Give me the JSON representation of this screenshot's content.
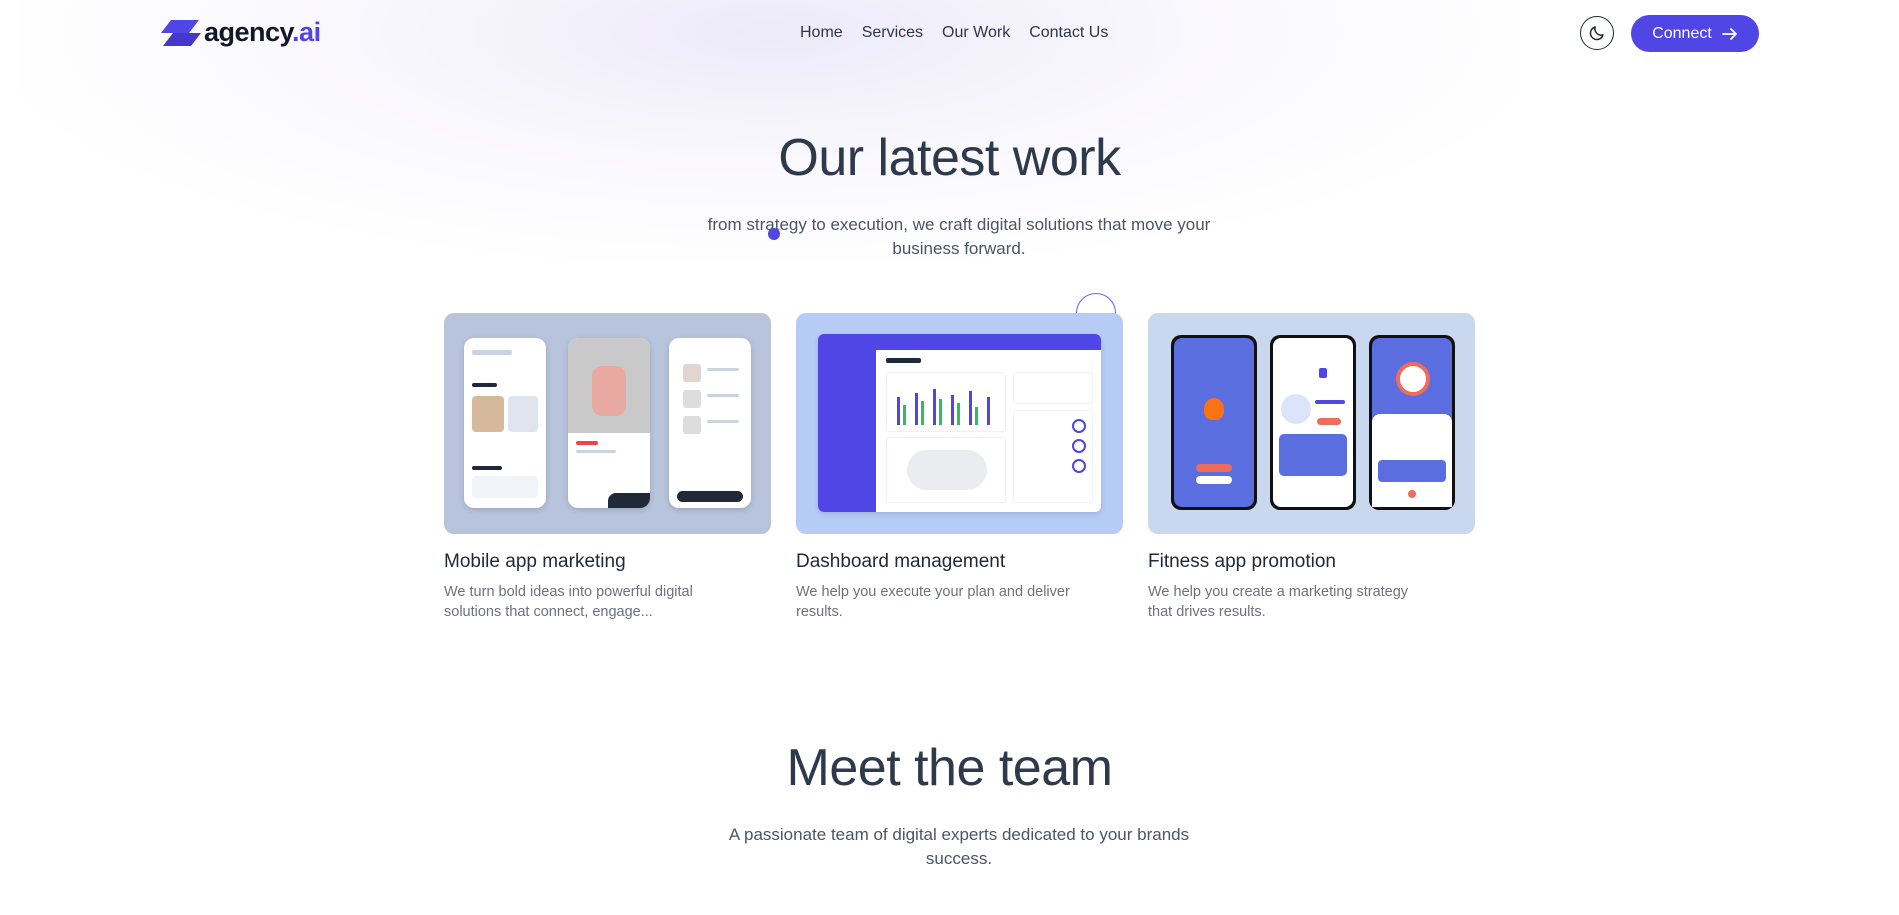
{
  "brand": {
    "name": "agency",
    "suffix": ".ai",
    "accent": "#4f46e5"
  },
  "nav": {
    "items": [
      {
        "label": "Home"
      },
      {
        "label": "Services"
      },
      {
        "label": "Our Work"
      },
      {
        "label": "Contact Us"
      }
    ]
  },
  "header": {
    "theme_toggle_icon": "moon-icon",
    "connect_label": "Connect",
    "connect_icon": "arrow-right-icon"
  },
  "work": {
    "title": "Our latest work",
    "subtitle": "from strategy to execution, we craft digital solutions that move your business forward.",
    "cards": [
      {
        "title": "Mobile app marketing",
        "description": "We turn bold ideas into powerful digital solutions that connect, engage...",
        "thumb_color": "#b8c4dc"
      },
      {
        "title": "Dashboard management",
        "description": "We help you execute your plan and deliver results.",
        "thumb_color": "#b7cbf7"
      },
      {
        "title": "Fitness app promotion",
        "description": "We help you create a marketing strategy that drives results.",
        "thumb_color": "#c9d8ee"
      }
    ]
  },
  "team": {
    "title": "Meet the team",
    "subtitle": "A passionate team of digital experts dedicated to your brands success."
  }
}
